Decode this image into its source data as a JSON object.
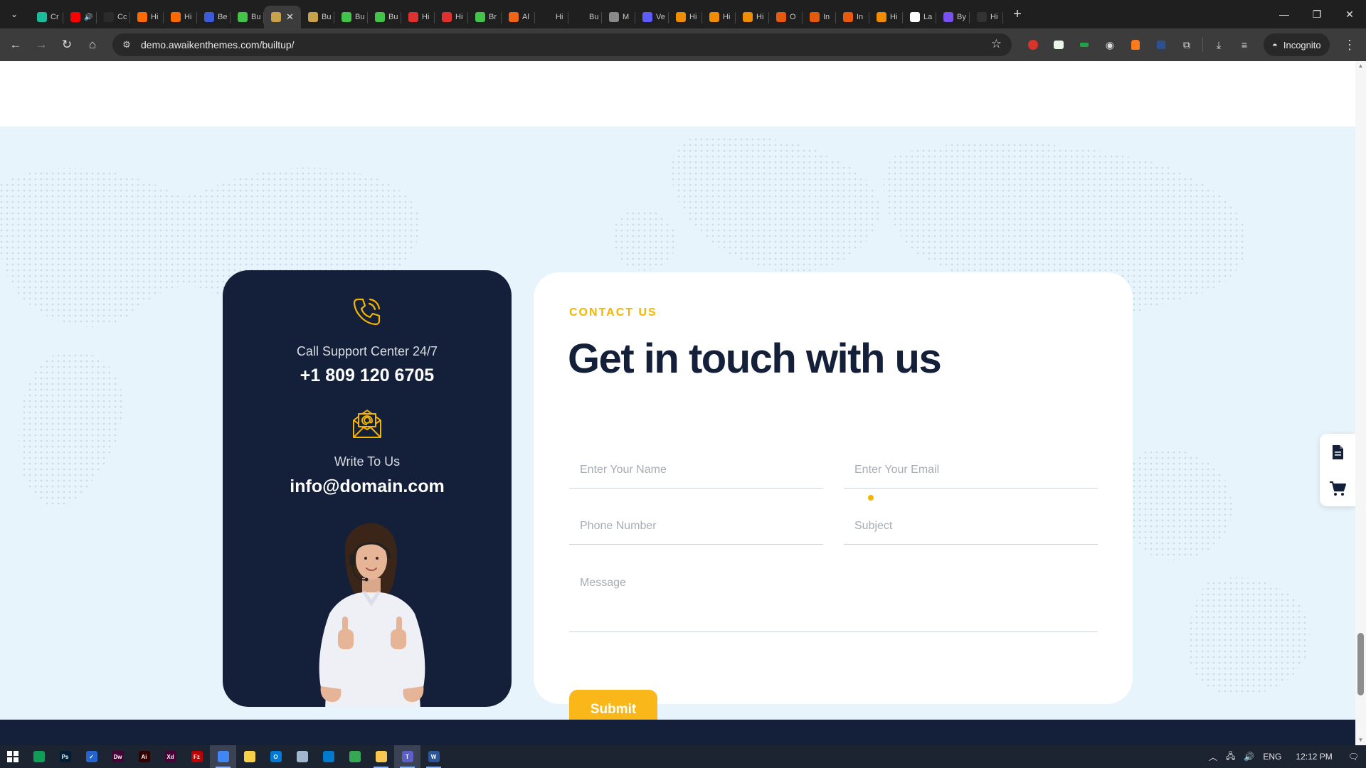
{
  "browser": {
    "tabs": [
      {
        "title": "Cr",
        "color": "#1abc9c"
      },
      {
        "title": "",
        "color": "#ff0000",
        "audio": true
      },
      {
        "title": "Cc",
        "color": "#2b2b2b"
      },
      {
        "title": "Hi",
        "color": "#ff6a00"
      },
      {
        "title": "Hi",
        "color": "#ff6a00"
      },
      {
        "title": "Be",
        "color": "#3b5bdb"
      },
      {
        "title": "Bu",
        "color": "#44c34a"
      },
      {
        "title": "",
        "color": "#c8a24a",
        "active": true
      },
      {
        "title": "Bu",
        "color": "#c8a24a"
      },
      {
        "title": "Bu",
        "color": "#44c34a"
      },
      {
        "title": "Bu",
        "color": "#44c34a"
      },
      {
        "title": "Hi",
        "color": "#e03131"
      },
      {
        "title": "Hi",
        "color": "#e03131"
      },
      {
        "title": "Br",
        "color": "#44c34a"
      },
      {
        "title": "Al",
        "color": "#f06418"
      },
      {
        "title": "Hi",
        "color": "#1f1f1f"
      },
      {
        "title": "Bu",
        "color": "#1f1f1f"
      },
      {
        "title": "M",
        "color": "#8a8a8a"
      },
      {
        "title": "Ve",
        "color": "#5c5cff"
      },
      {
        "title": "Hi",
        "color": "#f08c00"
      },
      {
        "title": "Hi",
        "color": "#f08c00"
      },
      {
        "title": "Hi",
        "color": "#f08c00"
      },
      {
        "title": "O",
        "color": "#e8590c"
      },
      {
        "title": "In",
        "color": "#e8590c"
      },
      {
        "title": "In",
        "color": "#e8590c"
      },
      {
        "title": "Hi",
        "color": "#f08c00"
      },
      {
        "title": "La",
        "color": "#ffffff"
      },
      {
        "title": "By",
        "color": "#7950f2"
      },
      {
        "title": "Hi",
        "color": "#333333"
      }
    ],
    "url": "demo.awaikenthemes.com/builtup/",
    "incognito_label": "Incognito"
  },
  "contact": {
    "support_label": "Call Support Center 24/7",
    "phone": "+1 809 120 6705",
    "write_label": "Write To Us",
    "email": "info@domain.com",
    "eyebrow": "CONTACT US",
    "heading": "Get in touch with us",
    "name_placeholder": "Enter Your Name",
    "email_placeholder": "Enter Your Email",
    "phone_placeholder": "Phone Number",
    "subject_placeholder": "Subject",
    "message_placeholder": "Message",
    "submit_label": "Submit",
    "accent": "#f4b400",
    "navy": "#14203a",
    "section_bg": "#e8f4fb"
  },
  "taskbar": {
    "apps": [
      {
        "name": "edge",
        "label": "",
        "color": "#0f9d58"
      },
      {
        "name": "photoshop",
        "label": "Ps",
        "color": "#001e36"
      },
      {
        "name": "todo",
        "label": "✓",
        "color": "#2564cf"
      },
      {
        "name": "dreamweaver",
        "label": "Dw",
        "color": "#470137"
      },
      {
        "name": "illustrator",
        "label": "Ai",
        "color": "#330000"
      },
      {
        "name": "xd",
        "label": "Xd",
        "color": "#470137"
      },
      {
        "name": "filezilla",
        "label": "Fz",
        "color": "#bf0000"
      },
      {
        "name": "chrome",
        "label": "",
        "color": "#4285f4",
        "running": true,
        "active": true
      },
      {
        "name": "sticky-notes",
        "label": "",
        "color": "#f7d046"
      },
      {
        "name": "outlook",
        "label": "O",
        "color": "#0078d4"
      },
      {
        "name": "notepad",
        "label": "",
        "color": "#9fb8d0"
      },
      {
        "name": "vscode",
        "label": "",
        "color": "#007acc"
      },
      {
        "name": "chrome-2",
        "label": "",
        "color": "#34a853"
      },
      {
        "name": "file-explorer",
        "label": "",
        "color": "#f9c74f",
        "running": true
      },
      {
        "name": "teams",
        "label": "T",
        "color": "#5b5fc7",
        "running": true,
        "active": true
      },
      {
        "name": "word",
        "label": "W",
        "color": "#2b579a",
        "running": true
      }
    ],
    "language": "ENG",
    "time": "12:12 PM"
  }
}
